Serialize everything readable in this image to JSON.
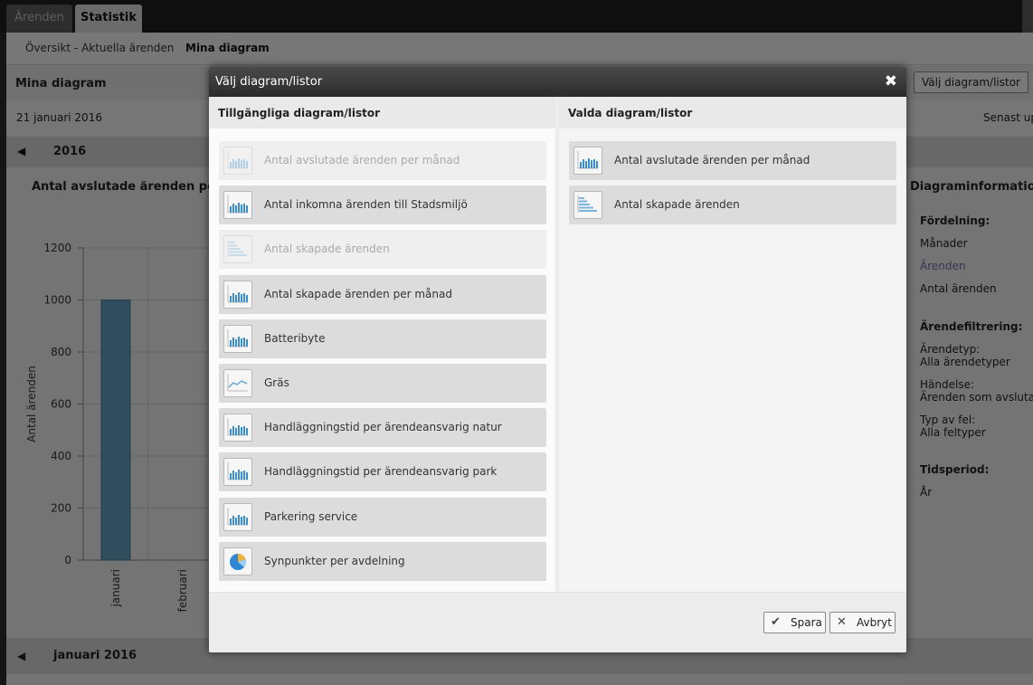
{
  "tabs": [
    {
      "label": "Ärenden"
    },
    {
      "label": "Statistik"
    }
  ],
  "subnav": [
    "Översikt - Aktuella ärenden",
    "Mina diagram"
  ],
  "page": {
    "title": "Mina diagram",
    "choose_button": "Välj diagram/listor",
    "date": "21 januari 2016",
    "last_updated": "Senast uppdaterad",
    "year_nav": "2016",
    "month_nav": "januari 2016"
  },
  "chart": {
    "title": "Antal avslutade ärenden per månad"
  },
  "chart_data": {
    "type": "bar",
    "categories": [
      "januari",
      "februari"
    ],
    "values": [
      1000,
      0
    ],
    "ylabel": "Antal ärenden",
    "ylim": [
      0,
      1200
    ],
    "yticks": [
      0,
      200,
      400,
      600,
      800,
      1000,
      1200
    ],
    "bar_color": "#5f9bb8",
    "grid": true
  },
  "info": {
    "title": "Diagraminformation",
    "fordelning_label": "Fördelning:",
    "manader": "Månader",
    "arenden": "Ärenden",
    "antal_arenden": "Antal ärenden",
    "filter_label": "Ärendefiltrering:",
    "arendetyp_label": "Ärendetyp:",
    "arendetyp_value": "Alla ärendetyper",
    "handelse_label": "Händelse:",
    "handelse_value": "Ärenden som avslutats",
    "typ_av_fel_label": "Typ av fel:",
    "typ_av_fel_value": "Alla feltyper",
    "tidsperiod_label": "Tidsperiod:",
    "tidsperiod_value": "År"
  },
  "modal": {
    "title": "Välj diagram/listor",
    "available_heading": "Tillgängliga diagram/listor",
    "selected_heading": "Valda diagram/listor",
    "available": [
      {
        "label": "Antal avslutade ärenden per månad",
        "icon": "bar-chart-icon",
        "disabled": true
      },
      {
        "label": "Antal inkomna ärenden till Stadsmiljö",
        "icon": "bar-chart-icon",
        "disabled": false
      },
      {
        "label": "Antal skapade ärenden",
        "icon": "list-chart-icon",
        "disabled": true
      },
      {
        "label": "Antal skapade ärenden per månad",
        "icon": "bar-chart-icon",
        "disabled": false
      },
      {
        "label": "Batteribyte",
        "icon": "bar-chart-icon",
        "disabled": false
      },
      {
        "label": "Gräs",
        "icon": "line-chart-icon",
        "disabled": false
      },
      {
        "label": "Handläggningstid per ärendeansvarig natur",
        "icon": "bar-chart-icon",
        "disabled": false
      },
      {
        "label": "Handläggningstid per ärendeansvarig park",
        "icon": "bar-chart-icon",
        "disabled": false
      },
      {
        "label": "Parkering service",
        "icon": "bar-chart-icon",
        "disabled": false
      },
      {
        "label": "Synpunkter per avdelning",
        "icon": "pie-chart-icon",
        "disabled": false
      }
    ],
    "selected": [
      {
        "label": "Antal avslutade ärenden per månad",
        "icon": "bar-chart-icon"
      },
      {
        "label": "Antal skapade ärenden",
        "icon": "list-chart-icon"
      }
    ],
    "save": "Spara",
    "cancel": "Avbryt"
  }
}
